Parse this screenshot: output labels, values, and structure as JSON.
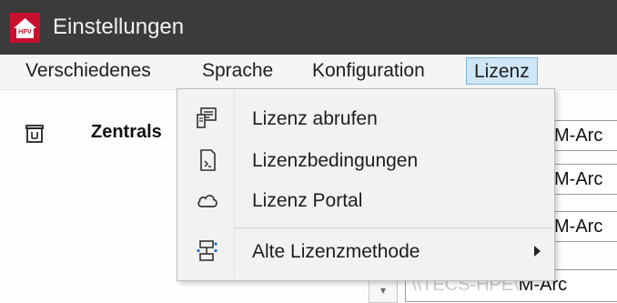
{
  "window": {
    "title": "Einstellungen",
    "app_icon": "house-logo-icon"
  },
  "menubar": {
    "items": [
      {
        "label": "Verschiedenes"
      },
      {
        "label": "Sprache"
      },
      {
        "label": "Konfiguration"
      },
      {
        "label": "Lizenz",
        "active": true
      }
    ]
  },
  "content": {
    "central_label": "Zentrals",
    "central_icon": "building-icon",
    "path_fields": [
      {
        "value": "M-Arc"
      },
      {
        "value": "M-Arc"
      },
      {
        "value": "M-Arc"
      },
      {
        "prefix": "\\\\TECS-HPE\\",
        "value": "M-Arc"
      }
    ]
  },
  "license_menu": {
    "items": [
      {
        "label": "Lizenz abrufen",
        "icon": "license-fetch-icon"
      },
      {
        "label": "Lizenzbedingungen",
        "icon": "document-icon"
      },
      {
        "label": "Lizenz Portal",
        "icon": "cloud-icon"
      },
      {
        "label": "Alte Lizenzmethode",
        "icon": "network-icon",
        "has_submenu": true
      }
    ]
  },
  "colors": {
    "titlebar": "#3b3b3b",
    "menu_highlight": "#cfe6f7",
    "menu_highlight_border": "#7fb6e0",
    "accent_blue": "#1a73c8",
    "logo_red": "#c8102e"
  }
}
